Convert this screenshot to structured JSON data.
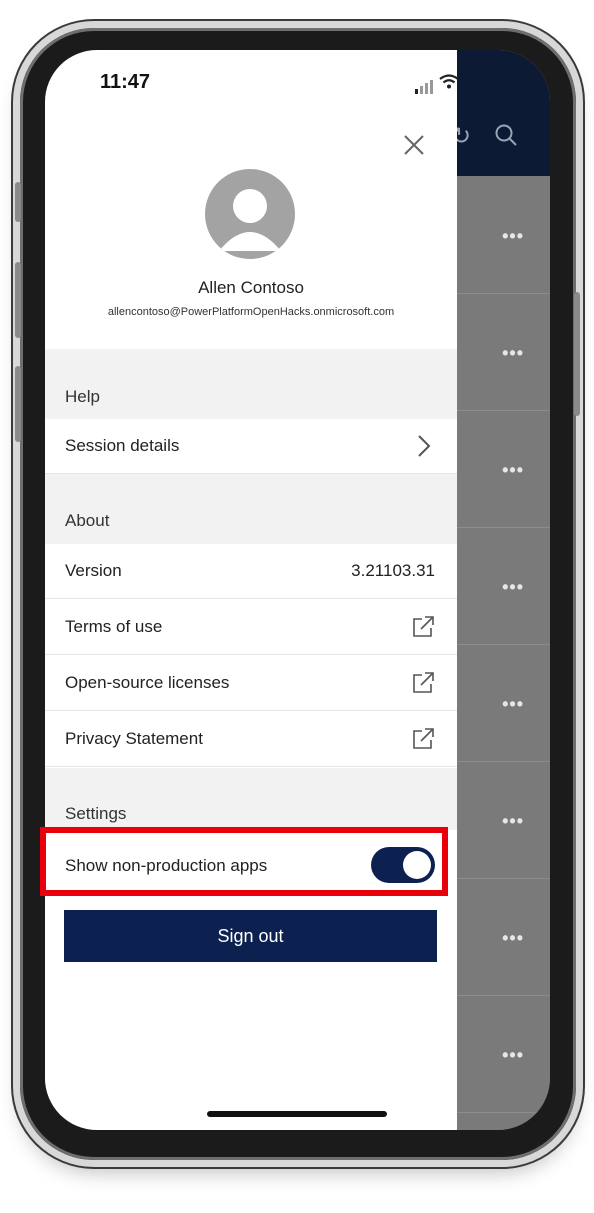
{
  "status_bar": {
    "time": "11:47"
  },
  "profile": {
    "name": "Allen Contoso",
    "email": "allencontoso@PowerPlatformOpenHacks.onmicrosoft.com"
  },
  "sections": {
    "help": {
      "title": "Help",
      "items": [
        {
          "label": "Session details",
          "icon": "chevron-right-icon"
        }
      ]
    },
    "about": {
      "title": "About",
      "items": [
        {
          "label": "Version",
          "value": "3.21103.31"
        },
        {
          "label": "Terms of use",
          "icon": "external-link-icon"
        },
        {
          "label": "Open-source licenses",
          "icon": "external-link-icon"
        },
        {
          "label": "Privacy Statement",
          "icon": "external-link-icon"
        }
      ]
    },
    "settings": {
      "title": "Settings",
      "items": [
        {
          "label": "Show non-production apps",
          "toggle_on": true
        }
      ]
    }
  },
  "sign_out_label": "Sign out",
  "background_app": {
    "row_menu_glyph": "•••",
    "header_icons": [
      "refresh-icon",
      "search-icon"
    ]
  },
  "colors": {
    "accent": "#0c2150",
    "highlight": "#e8000b",
    "section_bg": "#f2f2f2"
  }
}
